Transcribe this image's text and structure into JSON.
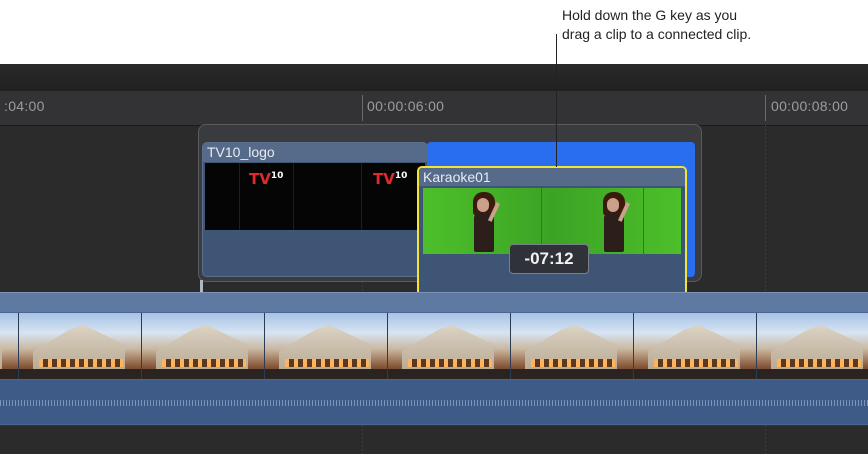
{
  "callout": {
    "line1": "Hold down the G key as you",
    "line2": "drag a clip to a connected clip."
  },
  "ruler": {
    "ticks": [
      ":04:00",
      "00:00:06:00",
      "00:00:08:00"
    ]
  },
  "clips": {
    "connected_clip_name": "TV10_logo",
    "dragged_clip_name": "Karaoke01",
    "logo_text": "TV",
    "logo_sup": "10",
    "drag_timecode": "-07:12"
  },
  "colors": {
    "timeline_bg": "#2b2b2c",
    "clip_blue": "#3f5575",
    "insert_highlight": "#2a6ef0",
    "selection_yellow": "#f2e33a",
    "logo_red": "#e22a2a"
  },
  "icons": {
    "anchor_marker": "connection-anchor-icon"
  }
}
